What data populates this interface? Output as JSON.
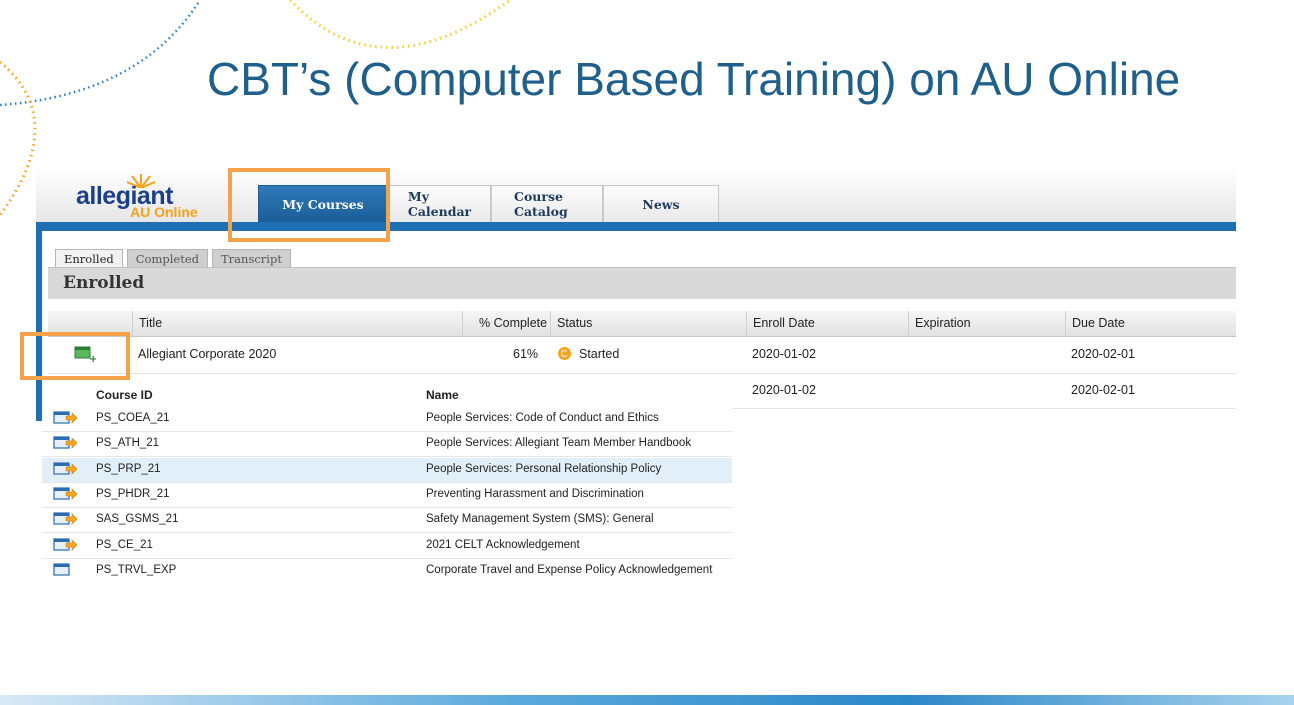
{
  "slide": {
    "title": "CBT’s (Computer Based Training) on AU Online"
  },
  "logo": {
    "brand": "allegiant",
    "sub": "AU Online"
  },
  "nav": {
    "tabs": [
      "My Courses",
      "My Calendar",
      "Course Catalog",
      "News"
    ],
    "active": "My Courses"
  },
  "subtabs": [
    "Enrolled",
    "Completed",
    "Transcript"
  ],
  "section": {
    "title": "Enrolled"
  },
  "grid": {
    "columns": [
      "Title",
      "% Complete",
      "Status",
      "Enroll Date",
      "Expiration",
      "Due Date"
    ],
    "rows": [
      {
        "title": "Allegiant Corporate 2020",
        "percent": "61%",
        "status": "Started",
        "enroll_date": "2020-01-02",
        "expiration": "",
        "due_date": "2020-02-01"
      },
      {
        "title": "",
        "percent": "",
        "status": "",
        "enroll_date": "2020-01-02",
        "expiration": "",
        "due_date": "2020-02-01"
      }
    ]
  },
  "subtable": {
    "columns": [
      "Course ID",
      "Name"
    ],
    "rows": [
      {
        "id": "PS_COEA_21",
        "name": "People Services: Code of Conduct and Ethics"
      },
      {
        "id": "PS_ATH_21",
        "name": "People Services: Allegiant Team Member Handbook"
      },
      {
        "id": "PS_PRP_21",
        "name": "People Services: Personal Relationship Policy"
      },
      {
        "id": "PS_PHDR_21",
        "name": "Preventing Harassment and Discrimination"
      },
      {
        "id": "SAS_GSMS_21",
        "name": "Safety Management System (SMS): General"
      },
      {
        "id": "PS_CE_21",
        "name": "2021 CELT Acknowledgement"
      },
      {
        "id": "PS_TRVL_EXP",
        "name": "Corporate Travel and Expense Policy Acknowledgement"
      }
    ]
  },
  "colors": {
    "accent": "#1f6fb2",
    "highlight_box": "#f5a24a",
    "title": "#1f5f8c",
    "status": "#f5a623"
  }
}
